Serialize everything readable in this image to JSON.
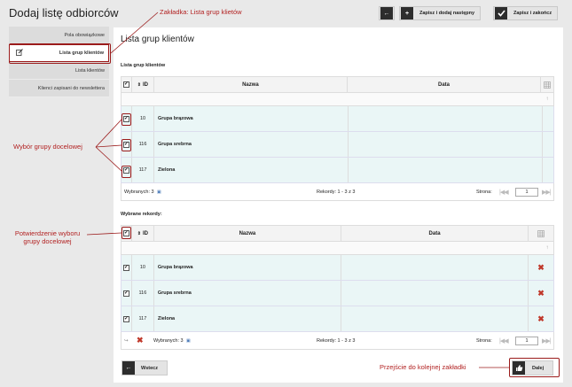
{
  "page": {
    "title": "Dodaj listę odbiorców"
  },
  "toolbar": {
    "back_icon": "←",
    "add_icon": "+",
    "save_next_label": "Zapisz i dodaj następny",
    "save_close_label": "Zapisz i zakończ"
  },
  "sidebar": {
    "items": [
      {
        "label": "Pola obowiązkowe"
      },
      {
        "label": "Lista grup klientów"
      },
      {
        "label": "Lista klientów"
      },
      {
        "label": "Klienci zapisani do newslettera"
      }
    ]
  },
  "panel": {
    "title": "Lista grup klientów"
  },
  "grid1": {
    "section_label": "Lista grup klientów",
    "columns": {
      "id": "ID",
      "name": "Nazwa",
      "date": "Data"
    },
    "rows": [
      {
        "id": "10",
        "name": "Grupa brązowa"
      },
      {
        "id": "116",
        "name": "Grupa srebrna"
      },
      {
        "id": "117",
        "name": "Zielona"
      }
    ],
    "selected_count": "Wybranych: 3",
    "records": "Rekordy: 1 - 3 z 3",
    "page_label": "Strona:",
    "page_value": "1"
  },
  "grid2": {
    "section_label": "Wybrane rekordy:",
    "columns": {
      "id": "ID",
      "name": "Nazwa",
      "date": "Data"
    },
    "rows": [
      {
        "id": "10",
        "name": "Grupa brązowa"
      },
      {
        "id": "116",
        "name": "Grupa srebrna"
      },
      {
        "id": "117",
        "name": "Zielona"
      }
    ],
    "selected_count": "Wybranych: 3",
    "records": "Rekordy: 1 - 3 z 3",
    "page_label": "Strona:",
    "page_value": "1"
  },
  "footer": {
    "back_label": "Wstecz",
    "next_label": "Dalej"
  },
  "annotations": {
    "tab": "Zakładka: Lista grup klietów",
    "select_group": "Wybór grupy docelowej",
    "confirm_line1": "Potwierdzenie wyboru",
    "confirm_line2": "grupy docelowej",
    "next_tab": "Przejście do kolejnej zakładki"
  },
  "colors": {
    "accent": "#b22222",
    "row_bg": "#eaf6f6",
    "dark_button": "#2d2d2d"
  }
}
